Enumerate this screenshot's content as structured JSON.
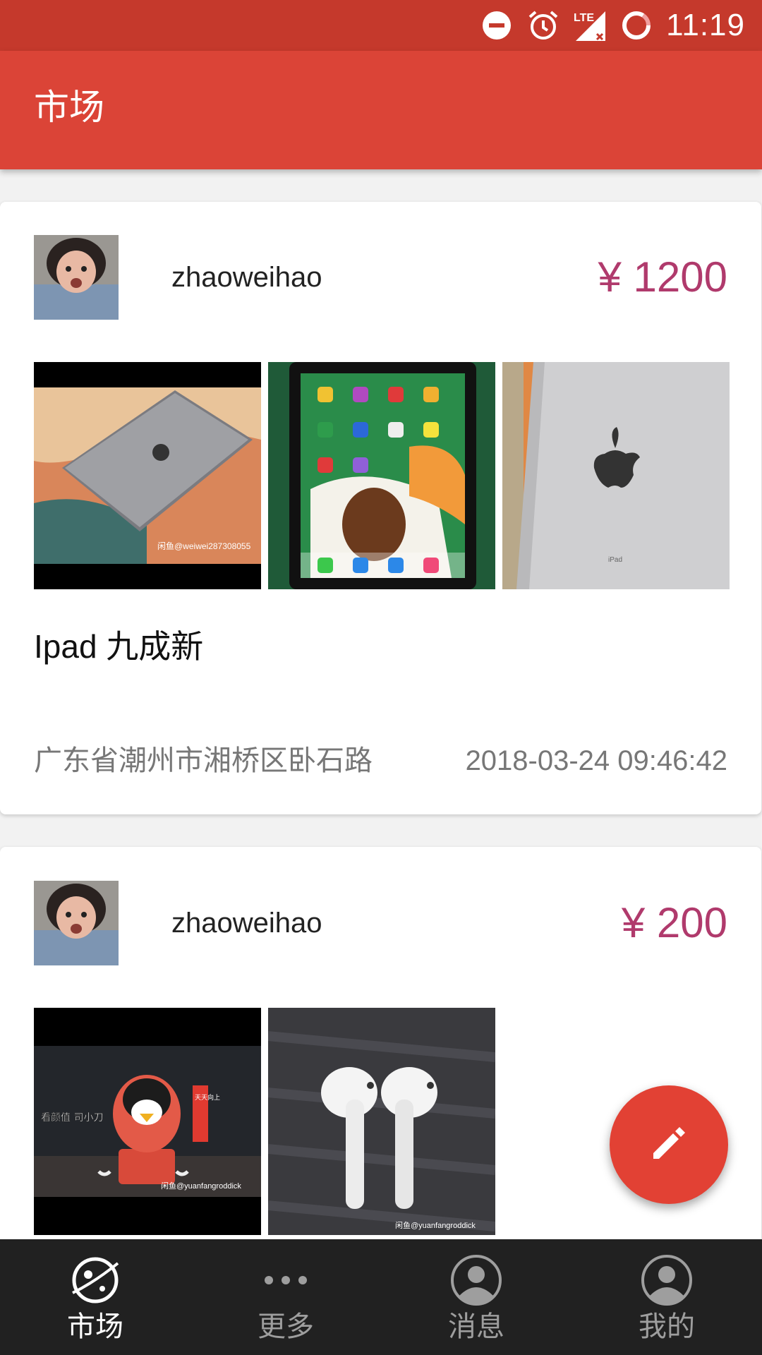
{
  "status_bar": {
    "time": "11:19",
    "icons": [
      "do-not-disturb-icon",
      "alarm-icon",
      "lte-signal-icon",
      "battery-icon"
    ]
  },
  "app_bar": {
    "title": "市场"
  },
  "listings": [
    {
      "username": "zhaoweihao",
      "price": "¥ 1200",
      "title": "Ipad 九成新",
      "location": "广东省潮州市湘桥区卧石路",
      "datetime": "2018-03-24 09:46:42",
      "photos": [
        {
          "subject": "ipad-back-on-tiger-cloth",
          "watermark": "闲鱼@weiwei287308055"
        },
        {
          "subject": "ipad-screen-home"
        },
        {
          "subject": "ipad-silver-back"
        }
      ]
    },
    {
      "username": "zhaoweihao",
      "price": "¥ 200",
      "photos": [
        {
          "subject": "penguin-figure-with-airpods",
          "sticker": "看颜值 司小刀",
          "banner": "天天向上",
          "watermark": "闲鱼@yuanfangroddick"
        },
        {
          "subject": "airpods-on-table",
          "watermark": "闲鱼@yuanfangroddick"
        }
      ]
    }
  ],
  "fab": {
    "icon": "pencil-icon"
  },
  "bottom_nav": [
    {
      "label": "市场",
      "icon": "planet-icon",
      "active": true
    },
    {
      "label": "更多",
      "icon": "more-dots-icon",
      "active": false
    },
    {
      "label": "消息",
      "icon": "person-circle-icon",
      "active": false
    },
    {
      "label": "我的",
      "icon": "person-circle-icon",
      "active": false
    }
  ],
  "colors": {
    "status_bar": "#c5392c",
    "app_bar": "#db4437",
    "price": "#b03a6c",
    "fab": "#e24134",
    "bottom_nav": "#212121"
  }
}
